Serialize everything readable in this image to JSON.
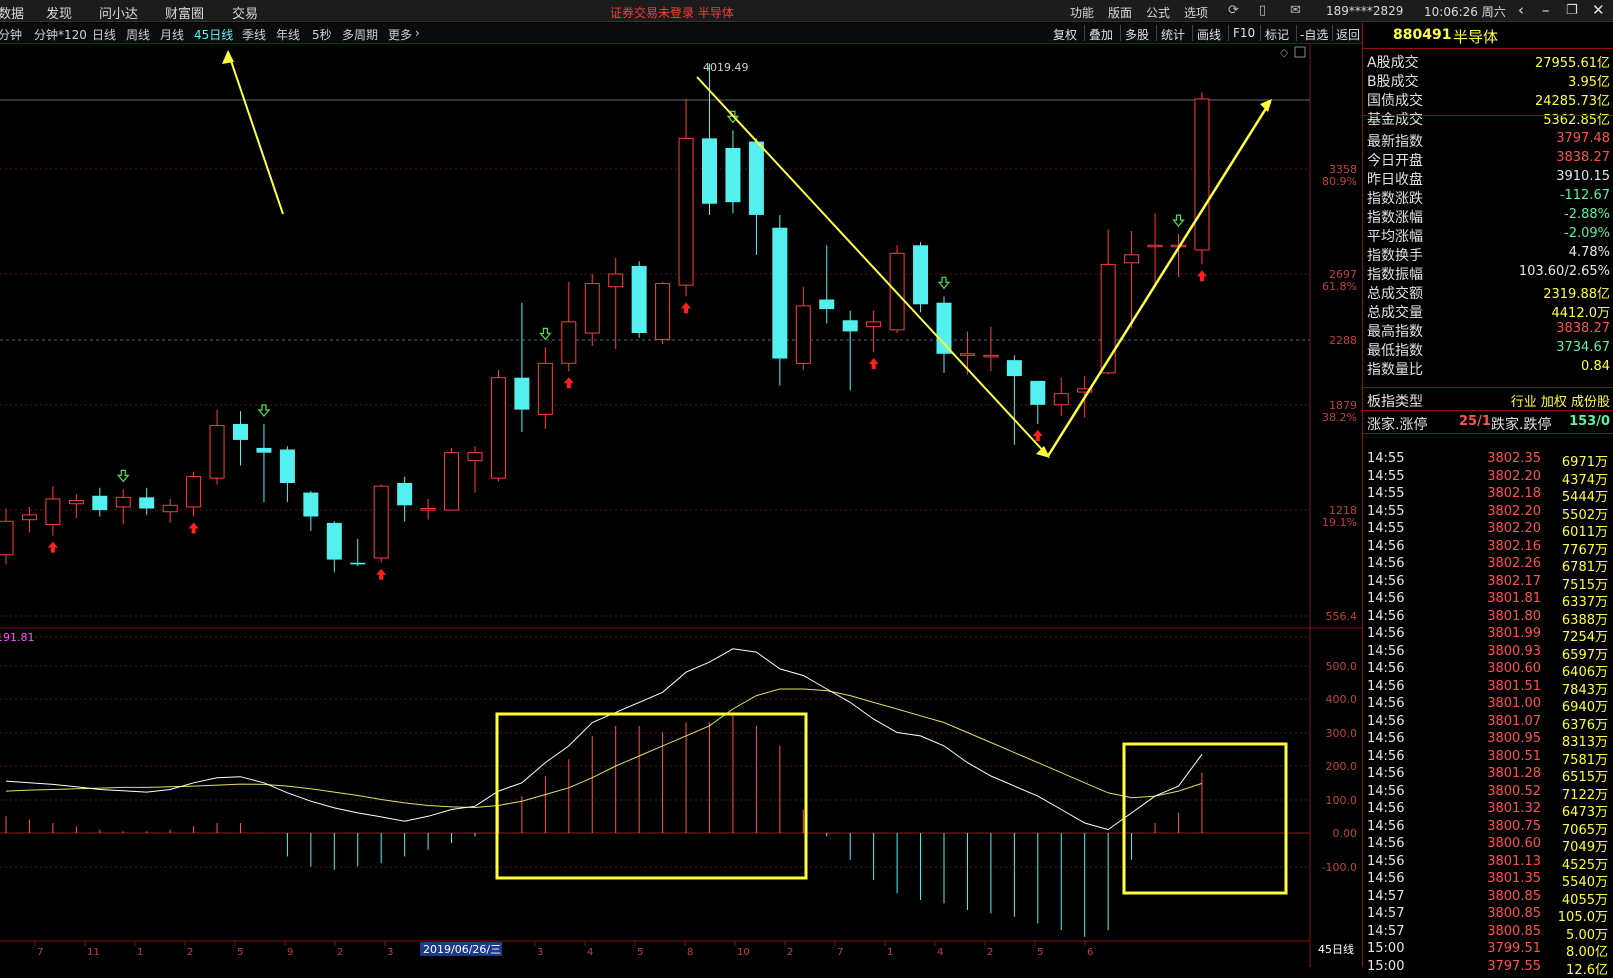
{
  "menu": {
    "items": [
      "数据",
      "发现",
      "问小达",
      "财富圈",
      "交易"
    ],
    "login_notice": "证券交易未登录  半导体"
  },
  "topright": {
    "items": [
      "功能",
      "版面",
      "公式",
      "选项"
    ],
    "phone": "189****2829",
    "clock": "10:06:26 周六"
  },
  "periods": {
    "items": [
      "分钟",
      "分钟*120",
      "日线",
      "周线",
      "月线",
      "45日线",
      "季线",
      "年线",
      "5秒",
      "多周期",
      "更多"
    ],
    "active": "45日线"
  },
  "tools": [
    "复权",
    "叠加",
    "多股",
    "统计",
    "画线",
    "F10",
    "标记",
    "-自选",
    "返回"
  ],
  "chart": {
    "high_label": "4019.49",
    "price_axis": [
      {
        "label": "3358",
        "pct": "80.9%"
      },
      {
        "label": "2697",
        "pct": "61.8%"
      },
      {
        "label": "2288",
        "pct": ""
      },
      {
        "label": "1879",
        "pct": "38.2%"
      },
      {
        "label": "1218",
        "pct": "19.1%"
      },
      {
        "label": "556.4",
        "pct": ""
      }
    ],
    "macd_title": "191.81",
    "macd_axis": [
      "500.0",
      "400.0",
      "300.0",
      "200.0",
      "100.0",
      "0.00",
      "-100.0"
    ],
    "date_label": "2019/06/26/三",
    "period_tag": "45日线",
    "bottom_ticks": [
      "7",
      "11",
      "1",
      "2",
      "5",
      "9",
      "2",
      "3",
      "7",
      "2",
      "3",
      "4",
      "5",
      "8",
      "10",
      "2",
      "7",
      "1",
      "4",
      "2",
      "5",
      "6"
    ],
    "colors": {
      "up": "#ff3c3c",
      "down": "#54f0f0",
      "ma": "#e0e060",
      "dif": "#ffffff"
    }
  },
  "chart_data": {
    "type": "candlestick",
    "period": "45日线",
    "high_marker": 4019.49,
    "y_axis": [
      556.4,
      1218,
      1879,
      2288,
      2697,
      3358
    ],
    "candles": [
      {
        "o": 940,
        "c": 1150,
        "h": 1230,
        "l": 880
      },
      {
        "o": 1160,
        "c": 1190,
        "h": 1240,
        "l": 1080
      },
      {
        "o": 1130,
        "c": 1290,
        "h": 1370,
        "l": 1060
      },
      {
        "o": 1260,
        "c": 1280,
        "h": 1320,
        "l": 1170
      },
      {
        "o": 1310,
        "c": 1220,
        "h": 1360,
        "l": 1180
      },
      {
        "o": 1240,
        "c": 1300,
        "h": 1350,
        "l": 1130
      },
      {
        "o": 1300,
        "c": 1230,
        "h": 1360,
        "l": 1190
      },
      {
        "o": 1210,
        "c": 1250,
        "h": 1290,
        "l": 1140
      },
      {
        "o": 1240,
        "c": 1430,
        "h": 1460,
        "l": 1180
      },
      {
        "o": 1420,
        "c": 1750,
        "h": 1850,
        "l": 1380
      },
      {
        "o": 1760,
        "c": 1660,
        "h": 1840,
        "l": 1500
      },
      {
        "o": 1610,
        "c": 1580,
        "h": 1760,
        "l": 1270
      },
      {
        "o": 1600,
        "c": 1390,
        "h": 1620,
        "l": 1270
      },
      {
        "o": 1330,
        "c": 1180,
        "h": 1340,
        "l": 1090
      },
      {
        "o": 1140,
        "c": 910,
        "h": 1150,
        "l": 830
      },
      {
        "o": 890,
        "c": 880,
        "h": 1040,
        "l": 870
      },
      {
        "o": 920,
        "c": 1370,
        "h": 1380,
        "l": 890
      },
      {
        "o": 1390,
        "c": 1250,
        "h": 1430,
        "l": 1150
      },
      {
        "o": 1220,
        "c": 1230,
        "h": 1290,
        "l": 1160
      },
      {
        "o": 1220,
        "c": 1580,
        "h": 1610,
        "l": 1240
      },
      {
        "o": 1530,
        "c": 1580,
        "h": 1620,
        "l": 1330
      },
      {
        "o": 1420,
        "c": 2050,
        "h": 2100,
        "l": 1400
      },
      {
        "o": 2050,
        "c": 1850,
        "h": 2520,
        "l": 1710
      },
      {
        "o": 1820,
        "c": 2140,
        "h": 2240,
        "l": 1730
      },
      {
        "o": 2140,
        "c": 2400,
        "h": 2650,
        "l": 2090
      },
      {
        "o": 2330,
        "c": 2640,
        "h": 2700,
        "l": 2250
      },
      {
        "o": 2620,
        "c": 2700,
        "h": 2800,
        "l": 2230
      },
      {
        "o": 2750,
        "c": 2330,
        "h": 2780,
        "l": 2300
      },
      {
        "o": 2290,
        "c": 2640,
        "h": 2650,
        "l": 2260
      },
      {
        "o": 2630,
        "c": 3550,
        "h": 3800,
        "l": 2560
      },
      {
        "o": 3550,
        "c": 3140,
        "h": 4019,
        "l": 3070
      },
      {
        "o": 3490,
        "c": 3150,
        "h": 3600,
        "l": 3080
      },
      {
        "o": 3530,
        "c": 3070,
        "h": 3550,
        "l": 2820
      },
      {
        "o": 2990,
        "c": 2170,
        "h": 3070,
        "l": 2000
      },
      {
        "o": 2140,
        "c": 2500,
        "h": 2620,
        "l": 2100
      },
      {
        "o": 2540,
        "c": 2480,
        "h": 2880,
        "l": 2390
      },
      {
        "o": 2410,
        "c": 2340,
        "h": 2470,
        "l": 1970
      },
      {
        "o": 2370,
        "c": 2400,
        "h": 2470,
        "l": 2210
      },
      {
        "o": 2350,
        "c": 2830,
        "h": 2880,
        "l": 2330
      },
      {
        "o": 2880,
        "c": 2510,
        "h": 2900,
        "l": 2460
      },
      {
        "o": 2520,
        "c": 2200,
        "h": 2560,
        "l": 2080
      },
      {
        "o": 2190,
        "c": 2200,
        "h": 2340,
        "l": 2070
      },
      {
        "o": 2190,
        "c": 2190,
        "h": 2370,
        "l": 2090
      },
      {
        "o": 2160,
        "c": 2060,
        "h": 2190,
        "l": 1630
      },
      {
        "o": 2030,
        "c": 1880,
        "h": 2030,
        "l": 1760
      },
      {
        "o": 1880,
        "c": 1950,
        "h": 2050,
        "l": 1810
      },
      {
        "o": 1960,
        "c": 1980,
        "h": 2060,
        "l": 1800
      },
      {
        "o": 2080,
        "c": 2760,
        "h": 2980,
        "l": 2070
      },
      {
        "o": 2770,
        "c": 2820,
        "h": 2970,
        "l": 2360
      },
      {
        "o": 2880,
        "c": 2880,
        "h": 3080,
        "l": 2620
      },
      {
        "o": 2880,
        "c": 2880,
        "h": 2950,
        "l": 2680
      },
      {
        "o": 2850,
        "c": 3797,
        "h": 3838,
        "l": 2760
      }
    ],
    "macd": {
      "dif": [
        155,
        150,
        145,
        138,
        130,
        126,
        122,
        130,
        150,
        165,
        168,
        150,
        120,
        95,
        75,
        60,
        48,
        35,
        50,
        70,
        80,
        125,
        150,
        210,
        260,
        330,
        360,
        390,
        420,
        480,
        510,
        550,
        540,
        490,
        470,
        430,
        390,
        340,
        300,
        290,
        260,
        210,
        170,
        140,
        110,
        70,
        30,
        10,
        60,
        110,
        140,
        235
      ],
      "dea": [
        125,
        128,
        130,
        132,
        134,
        136,
        136,
        138,
        140,
        143,
        146,
        145,
        140,
        132,
        122,
        112,
        100,
        90,
        82,
        78,
        76,
        82,
        95,
        115,
        135,
        165,
        200,
        230,
        260,
        290,
        320,
        370,
        410,
        430,
        430,
        425,
        410,
        390,
        370,
        350,
        330,
        300,
        270,
        240,
        210,
        180,
        150,
        120,
        105,
        110,
        125,
        148
      ],
      "hist": [
        50,
        40,
        30,
        20,
        10,
        5,
        5,
        10,
        20,
        30,
        30,
        0,
        -70,
        -100,
        -110,
        -100,
        -90,
        -70,
        -50,
        -30,
        -10,
        80,
        110,
        170,
        220,
        290,
        320,
        320,
        300,
        330,
        330,
        350,
        320,
        260,
        70,
        -10,
        -80,
        -140,
        -180,
        -200,
        -210,
        -230,
        -240,
        -250,
        -270,
        -290,
        -310,
        -290,
        -80,
        30,
        60,
        180
      ]
    }
  },
  "sidebar": {
    "code": "880491",
    "name": "半导体",
    "stats": [
      {
        "label": "A股成交",
        "value": "27955.61亿",
        "color": "#ffff3c"
      },
      {
        "label": "B股成交",
        "value": "3.95亿",
        "color": "#ffff3c"
      },
      {
        "label": "国债成交",
        "value": "24285.73亿",
        "color": "#ffff3c"
      },
      {
        "label": "基金成交",
        "value": "5362.85亿",
        "color": "#ffff3c"
      },
      {
        "label": "最新指数",
        "value": "3797.48",
        "color": "#ff5050"
      },
      {
        "label": "今日开盘",
        "value": "3838.27",
        "color": "#ff5050"
      },
      {
        "label": "昨日收盘",
        "value": "3910.15",
        "color": "#e6e6e6"
      },
      {
        "label": "指数涨跌",
        "value": "-112.67",
        "color": "#5cf0a0"
      },
      {
        "label": "指数涨幅",
        "value": "-2.88%",
        "color": "#5cf0a0"
      },
      {
        "label": "平均涨幅",
        "value": "-2.09%",
        "color": "#5cf0a0"
      },
      {
        "label": "指数换手",
        "value": "4.78%",
        "color": "#e6e6e6"
      },
      {
        "label": "指数振幅",
        "value": "103.60/2.65%",
        "color": "#e6e6e6"
      },
      {
        "label": "总成交额",
        "value": "2319.88亿",
        "color": "#ffff3c"
      },
      {
        "label": "总成交量",
        "value": "4412.0万",
        "color": "#ffff3c"
      },
      {
        "label": "最高指数",
        "value": "3838.27",
        "color": "#ff5050"
      },
      {
        "label": "最低指数",
        "value": "3734.67",
        "color": "#5cf0a0"
      },
      {
        "label": "指数量比",
        "value": "0.84",
        "color": "#ffff3c"
      }
    ],
    "index_type": {
      "label": "板指类型",
      "value": "行业 加权 成份股"
    },
    "breadth": {
      "up_label": "涨家.涨停",
      "up_value": "25/1",
      "down_label": "跌家.跌停",
      "down_value": "153/0"
    },
    "ticks": [
      {
        "t": "14:55",
        "p": "3802.35",
        "v": "6971万"
      },
      {
        "t": "14:55",
        "p": "3802.20",
        "v": "4374万"
      },
      {
        "t": "14:55",
        "p": "3802.18",
        "v": "5444万"
      },
      {
        "t": "14:55",
        "p": "3802.20",
        "v": "5502万"
      },
      {
        "t": "14:55",
        "p": "3802.20",
        "v": "6011万"
      },
      {
        "t": "14:56",
        "p": "3802.16",
        "v": "7767万"
      },
      {
        "t": "14:56",
        "p": "3802.26",
        "v": "6781万"
      },
      {
        "t": "14:56",
        "p": "3802.17",
        "v": "7515万"
      },
      {
        "t": "14:56",
        "p": "3801.81",
        "v": "6337万"
      },
      {
        "t": "14:56",
        "p": "3801.80",
        "v": "6388万"
      },
      {
        "t": "14:56",
        "p": "3801.99",
        "v": "7254万"
      },
      {
        "t": "14:56",
        "p": "3800.93",
        "v": "6597万"
      },
      {
        "t": "14:56",
        "p": "3800.60",
        "v": "6406万"
      },
      {
        "t": "14:56",
        "p": "3801.51",
        "v": "7843万"
      },
      {
        "t": "14:56",
        "p": "3801.00",
        "v": "6940万"
      },
      {
        "t": "14:56",
        "p": "3801.07",
        "v": "6376万"
      },
      {
        "t": "14:56",
        "p": "3800.95",
        "v": "8313万"
      },
      {
        "t": "14:56",
        "p": "3800.51",
        "v": "7581万"
      },
      {
        "t": "14:56",
        "p": "3801.28",
        "v": "6515万"
      },
      {
        "t": "14:56",
        "p": "3800.52",
        "v": "7122万"
      },
      {
        "t": "14:56",
        "p": "3801.32",
        "v": "6473万"
      },
      {
        "t": "14:56",
        "p": "3800.75",
        "v": "7065万"
      },
      {
        "t": "14:56",
        "p": "3800.60",
        "v": "7049万"
      },
      {
        "t": "14:56",
        "p": "3801.13",
        "v": "4525万"
      },
      {
        "t": "14:56",
        "p": "3801.35",
        "v": "5540万"
      },
      {
        "t": "14:57",
        "p": "3800.85",
        "v": "4055万"
      },
      {
        "t": "14:57",
        "p": "3800.85",
        "v": "105.0万"
      },
      {
        "t": "14:57",
        "p": "3800.85",
        "v": "5.00万"
      },
      {
        "t": "15:00",
        "p": "3799.51",
        "v": "8.00亿"
      },
      {
        "t": "15:00",
        "p": "3797.55",
        "v": "12.6亿"
      }
    ]
  }
}
